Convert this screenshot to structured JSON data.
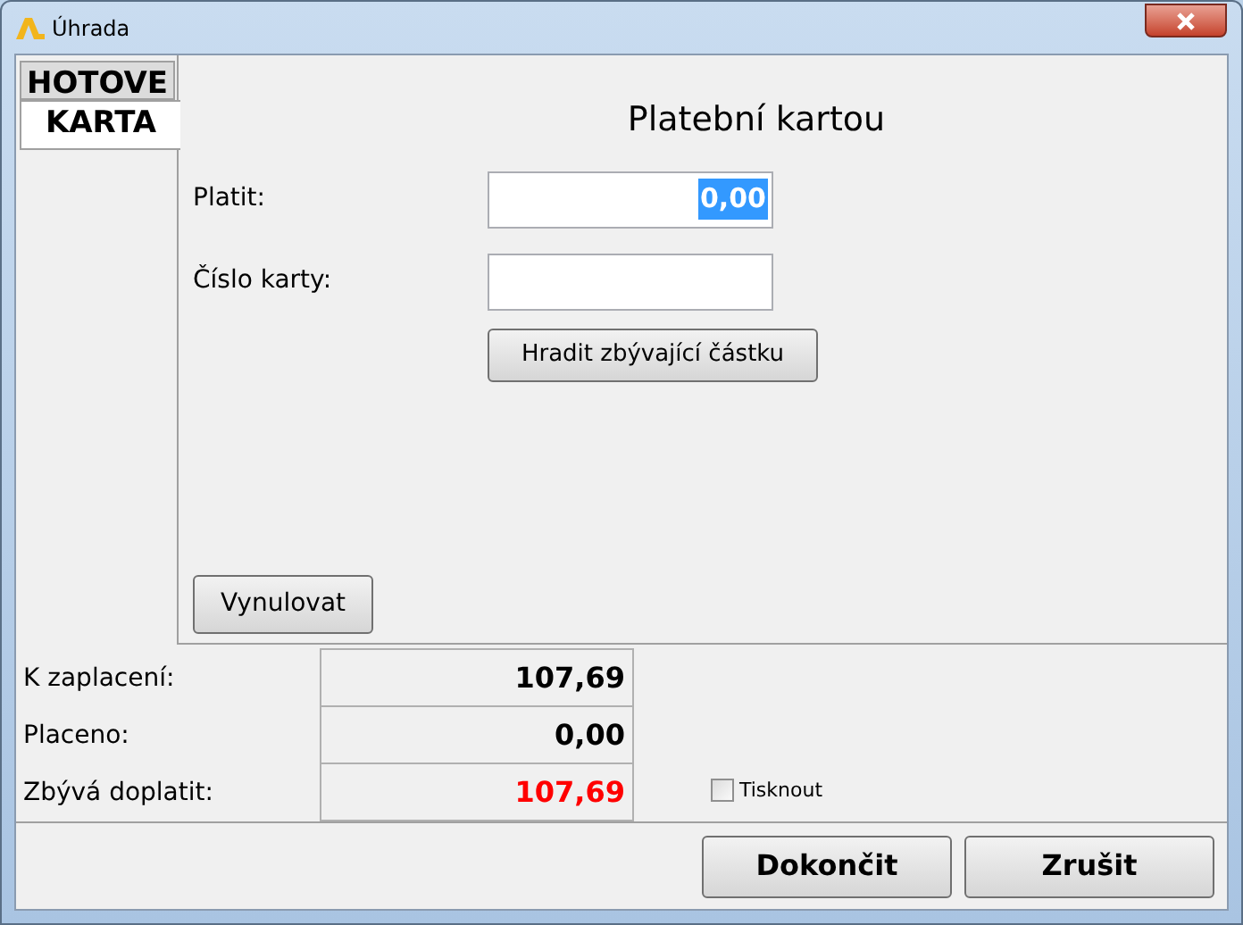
{
  "window": {
    "title": "Úhrada"
  },
  "tabs": [
    {
      "label": "HOTOVE",
      "selected": false
    },
    {
      "label": "KARTA",
      "selected": true
    }
  ],
  "panel": {
    "heading": "Platební kartou",
    "fields": [
      {
        "label": "Platit:",
        "value": "0,00",
        "text_selected": true
      },
      {
        "label": "Číslo karty:"
      }
    ],
    "pay_rest_button": "Hradit zbývající částku",
    "reset_button": "Vynulovat"
  },
  "summary": [
    {
      "label": "K zaplacení:",
      "value": "107,69",
      "alert": false
    },
    {
      "label": "Placeno:",
      "value": "0,00",
      "alert": false
    },
    {
      "label": "Zbývá doplatit:",
      "value": "107,69",
      "alert": true
    }
  ],
  "print_checkbox": {
    "label": "Tisknout",
    "checked": false
  },
  "buttons": [
    "Dokončit",
    "Zrušit"
  ]
}
